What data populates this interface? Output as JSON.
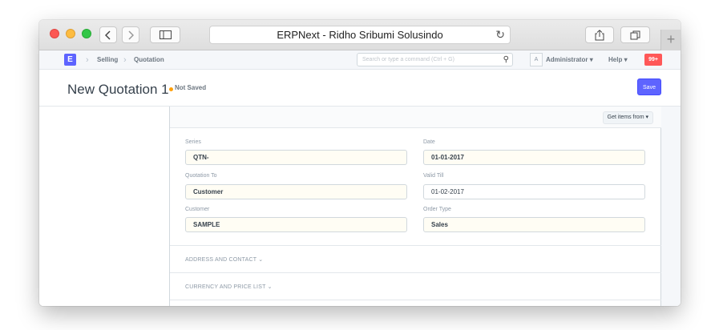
{
  "browser": {
    "url_title": "ERPNext - Ridho Sribumi Solusindo"
  },
  "navbar": {
    "logo_letter": "E",
    "breadcrumbs": [
      "Selling",
      "Quotation"
    ],
    "search_placeholder": "Search or type a command (Ctrl + G)",
    "avatar_letter": "A",
    "user": "Administrator",
    "help": "Help",
    "notifications": "99+"
  },
  "page": {
    "title": "New Quotation 1",
    "status": "Not Saved",
    "save_label": "Save"
  },
  "form": {
    "toolbar_action": "Get items from",
    "fields": {
      "series": {
        "label": "Series",
        "value": "QTN-"
      },
      "date": {
        "label": "Date",
        "value": "01-01-2017"
      },
      "quotation_to": {
        "label": "Quotation To",
        "value": "Customer"
      },
      "valid_till": {
        "label": "Valid Till",
        "value": "01-02-2017"
      },
      "customer": {
        "label": "Customer",
        "value": "SAMPLE"
      },
      "order_type": {
        "label": "Order Type",
        "value": "Sales"
      }
    },
    "sections": [
      "ADDRESS AND CONTACT",
      "CURRENCY AND PRICE LIST"
    ]
  },
  "colors": {
    "accent": "#5e64ff",
    "status_dot": "#ffa00a",
    "badge": "#ff5858"
  }
}
